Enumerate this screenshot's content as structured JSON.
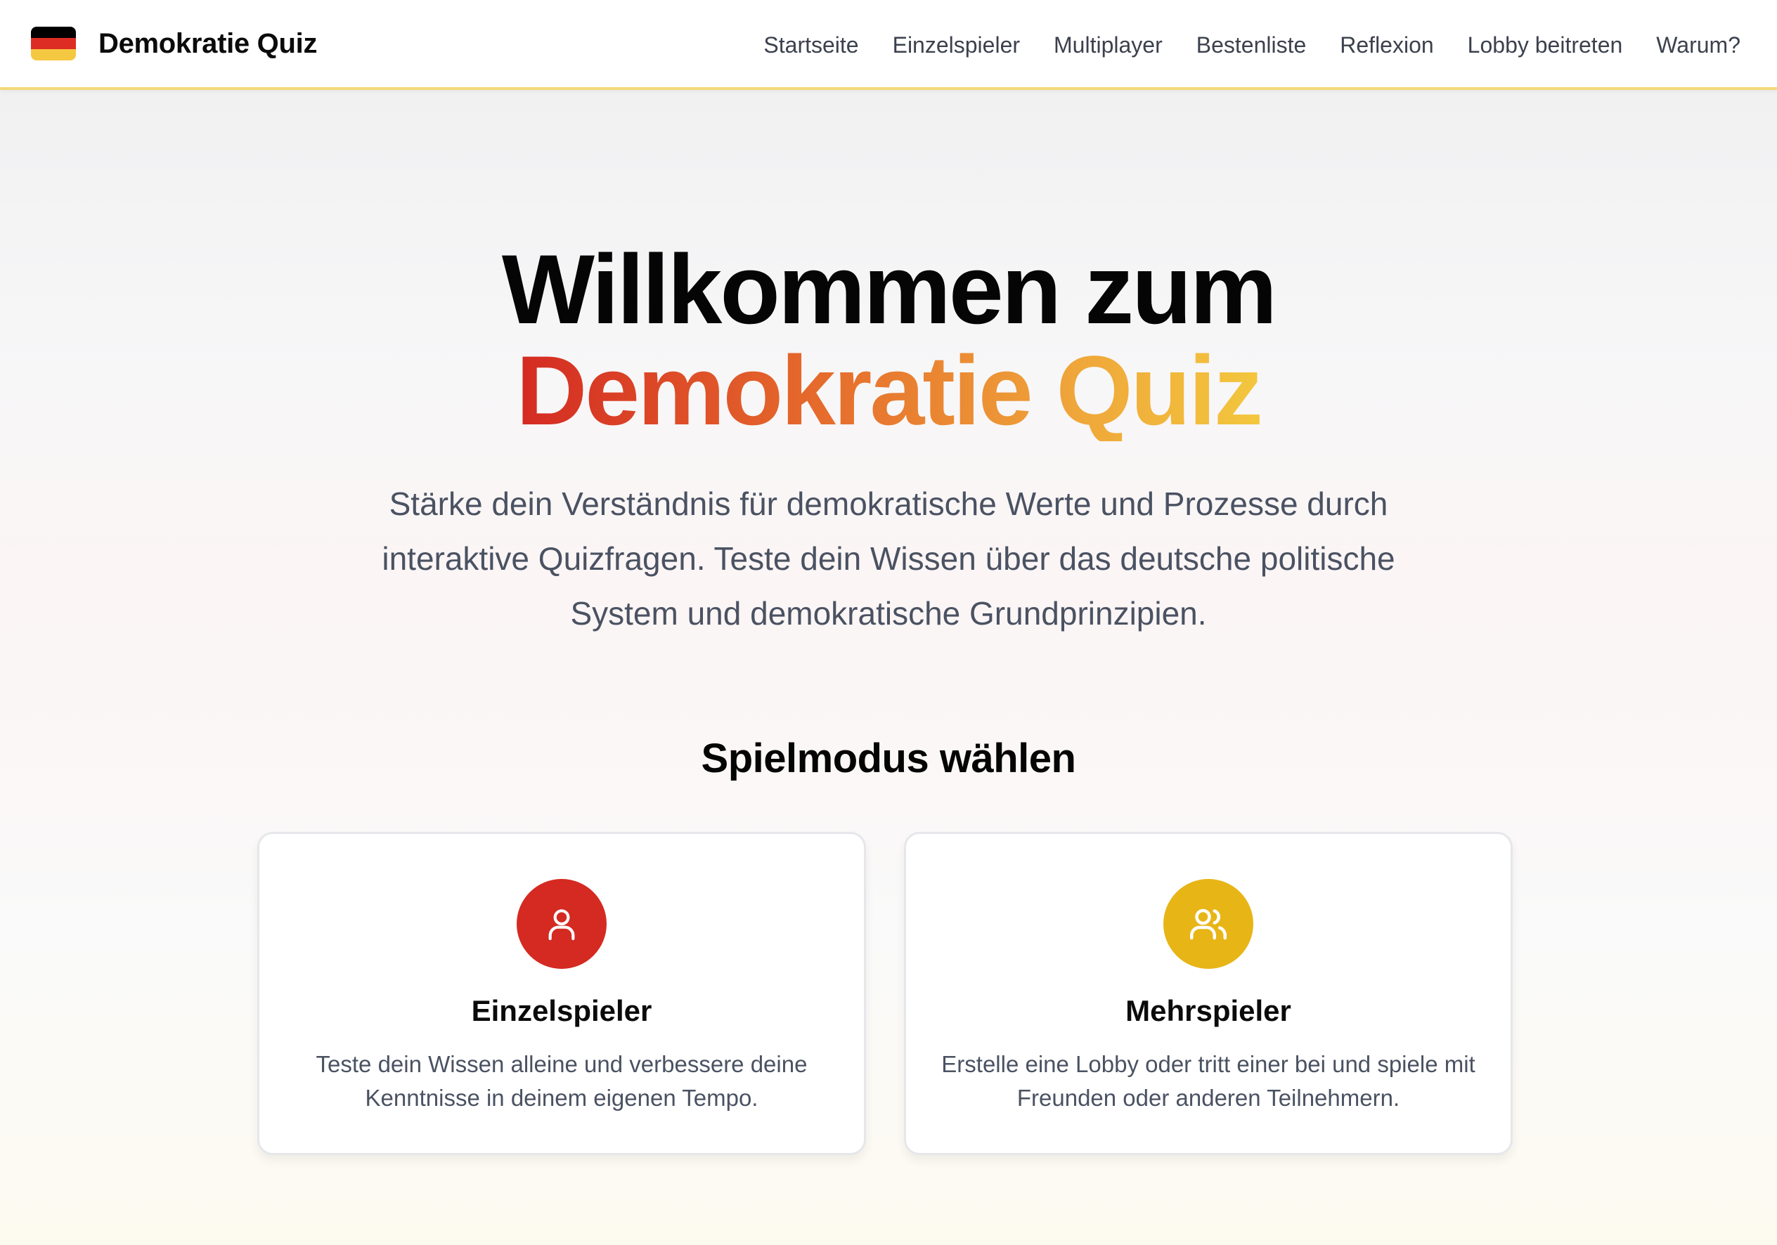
{
  "brand": {
    "name": "Demokratie Quiz",
    "flag_colors": [
      "#000000",
      "#dd2c23",
      "#f5c842"
    ]
  },
  "nav": {
    "items": [
      {
        "label": "Startseite"
      },
      {
        "label": "Einzelspieler"
      },
      {
        "label": "Multiplayer"
      },
      {
        "label": "Bestenliste"
      },
      {
        "label": "Reflexion"
      },
      {
        "label": "Lobby beitreten"
      },
      {
        "label": "Warum?"
      }
    ]
  },
  "hero": {
    "title_line1": "Willkommen zum",
    "title_line2": "Demokratie Quiz",
    "subtitle": "Stärke dein Verständnis für demokratische Werte und Prozesse durch interaktive Quizfragen. Teste dein Wissen über das deutsche politische System und demokratische Grundprinzipien."
  },
  "modes": {
    "heading": "Spielmodus wählen",
    "cards": [
      {
        "icon": "user-icon",
        "title": "Einzelspieler",
        "description": "Teste dein Wissen alleine und verbessere deine Kenntnisse in deinem eigenen Tempo.",
        "accent": "#d42a22"
      },
      {
        "icon": "users-icon",
        "title": "Mehrspieler",
        "description": "Erstelle eine Lobby oder tritt einer bei und spiele mit Freunden oder anderen Teilnehmern.",
        "accent": "#e8b517"
      }
    ]
  }
}
